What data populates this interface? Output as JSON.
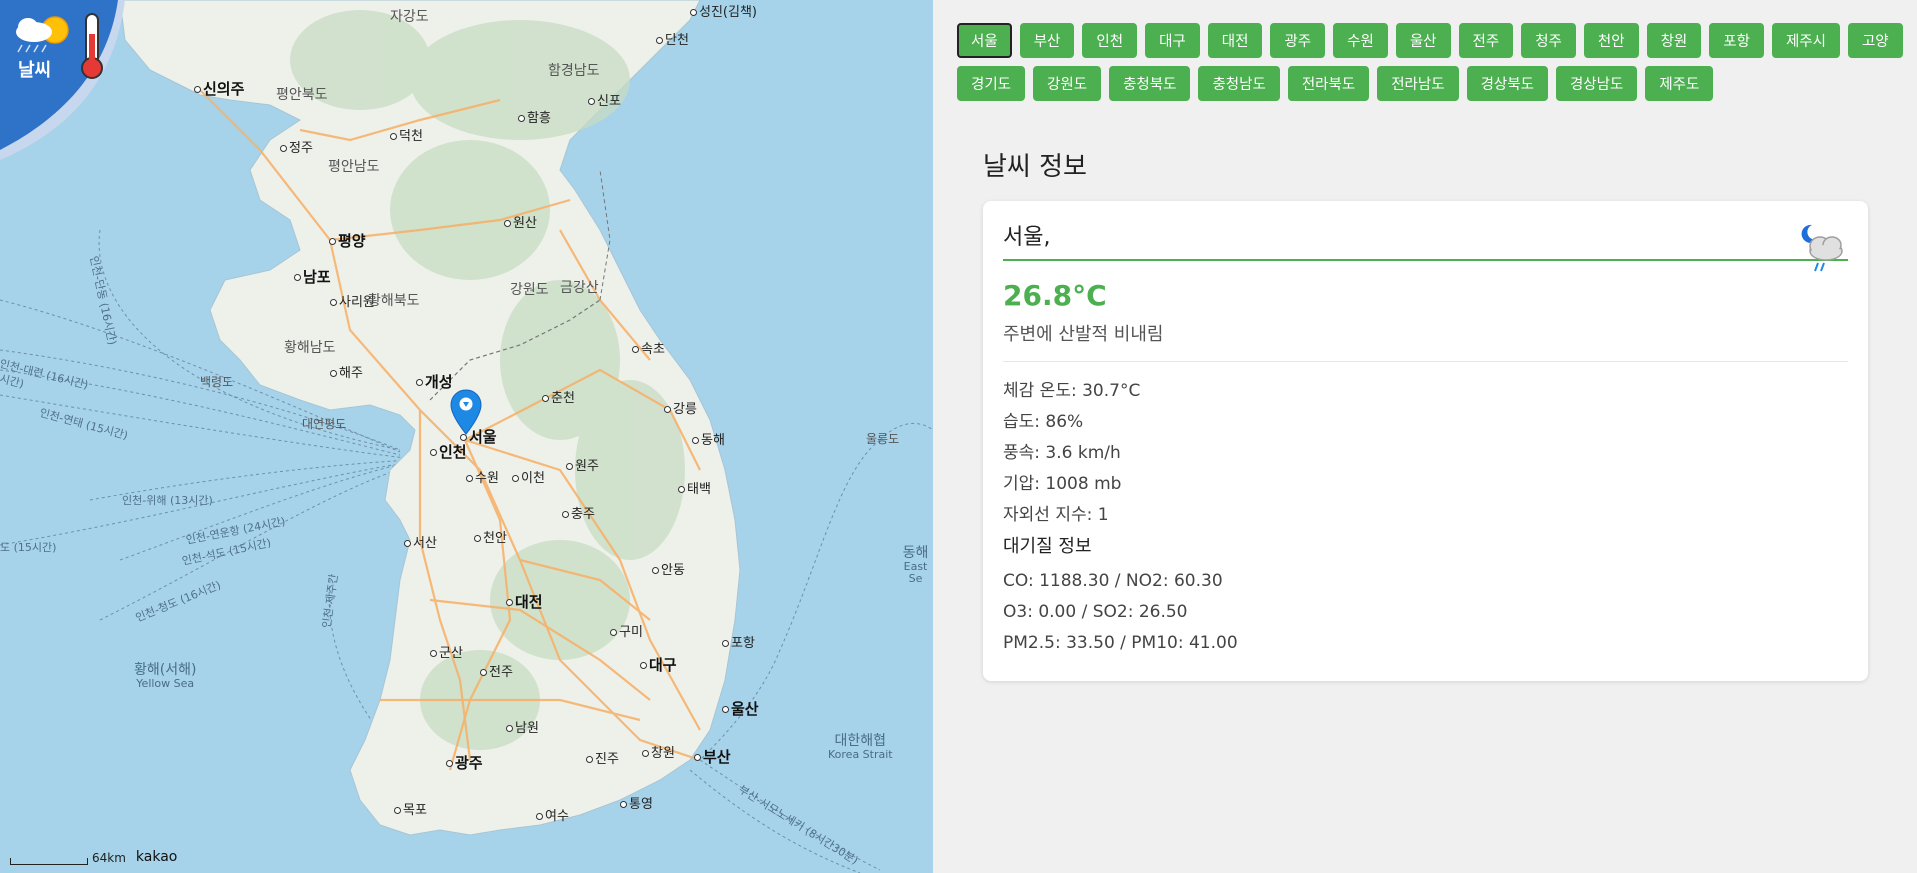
{
  "logo": {
    "text": "날씨"
  },
  "map": {
    "cities": [
      {
        "name": "성진(김책)",
        "big": false
      },
      {
        "name": "단천",
        "big": false
      },
      {
        "name": "신포",
        "big": false
      },
      {
        "name": "함흥",
        "big": false
      },
      {
        "name": "신의주",
        "big": true
      },
      {
        "name": "덕천",
        "big": false
      },
      {
        "name": "정주",
        "big": false
      },
      {
        "name": "원산",
        "big": false
      },
      {
        "name": "평양",
        "big": true
      },
      {
        "name": "남포",
        "big": true
      },
      {
        "name": "사리원",
        "big": false
      },
      {
        "name": "해주",
        "big": false
      },
      {
        "name": "개성",
        "big": true
      },
      {
        "name": "서울",
        "big": true
      },
      {
        "name": "인천",
        "big": true
      },
      {
        "name": "춘천",
        "big": false
      },
      {
        "name": "강릉",
        "big": false
      },
      {
        "name": "속초",
        "big": false
      },
      {
        "name": "동해",
        "big": false
      },
      {
        "name": "원주",
        "big": false
      },
      {
        "name": "수원",
        "big": false
      },
      {
        "name": "이천",
        "big": false
      },
      {
        "name": "충주",
        "big": false
      },
      {
        "name": "태백",
        "big": false
      },
      {
        "name": "서산",
        "big": false
      },
      {
        "name": "천안",
        "big": false
      },
      {
        "name": "안동",
        "big": false
      },
      {
        "name": "대전",
        "big": true
      },
      {
        "name": "구미",
        "big": false
      },
      {
        "name": "포항",
        "big": false
      },
      {
        "name": "군산",
        "big": false
      },
      {
        "name": "전주",
        "big": false
      },
      {
        "name": "대구",
        "big": true
      },
      {
        "name": "울산",
        "big": true
      },
      {
        "name": "남원",
        "big": false
      },
      {
        "name": "창원",
        "big": false
      },
      {
        "name": "부산",
        "big": true
      },
      {
        "name": "광주",
        "big": true
      },
      {
        "name": "진주",
        "big": false
      },
      {
        "name": "통영",
        "big": false
      },
      {
        "name": "목포",
        "big": false
      },
      {
        "name": "여수",
        "big": false
      }
    ],
    "regions": [
      "자강도",
      "함경남도",
      "평안북도",
      "평안남도",
      "강원도",
      "금강산",
      "황해북도",
      "황해남도",
      "백령도",
      "대연평도",
      "울릉도"
    ],
    "seas": [
      {
        "name": "황해(서해)",
        "en": "Yellow Sea"
      },
      {
        "name": "대한해협",
        "en": "Korea Strait"
      },
      {
        "name": "동해",
        "en": "East Se"
      }
    ],
    "routes": [
      "인천-대련 (16시간)",
      "인천-연태 (15시간)",
      "인천-위해 (13시간)",
      "인천-연운항 (24시간)",
      "인천-석도 (15시간)",
      "인천-청도 (16시간)",
      "도 (15시간)",
      "인천-단동 (16시간)",
      "인천-제주간",
      "부산-시모노세키 (8시간30분)",
      "시간)"
    ],
    "scale_label": "64km",
    "attribution": "kakao"
  },
  "city_buttons": [
    "서울",
    "부산",
    "인천",
    "대구",
    "대전",
    "광주",
    "수원",
    "울산",
    "전주",
    "청주",
    "천안",
    "창원",
    "포항",
    "제주시",
    "고양",
    "경기도",
    "강원도",
    "충청북도",
    "충청남도",
    "전라북도",
    "전라남도",
    "경상북도",
    "경상남도",
    "제주도"
  ],
  "active_city": "서울",
  "info": {
    "section_title": "날씨 정보",
    "city_label": "서울,",
    "weather_icon": "night-rain-cloud-icon",
    "temperature": "26.8°C",
    "description": "주변에 산발적 비내림",
    "feels_like": "체감 온도: 30.7°C",
    "humidity": "습도: 86%",
    "wind": "풍속: 3.6 km/h",
    "pressure": "기압: 1008 mb",
    "uv": "자외선 지수: 1",
    "air_quality_title": "대기질 정보",
    "co_no2": "CO: 1188.30 / NO2: 60.30",
    "o3_so2": "O3: 0.00 / SO2: 26.50",
    "pm": "PM2.5: 33.50 / PM10: 41.00"
  },
  "colors": {
    "accent": "#4caf50",
    "logo_blue": "#2f73c9",
    "sea": "#a6d3ea",
    "land": "#eef0ea"
  }
}
